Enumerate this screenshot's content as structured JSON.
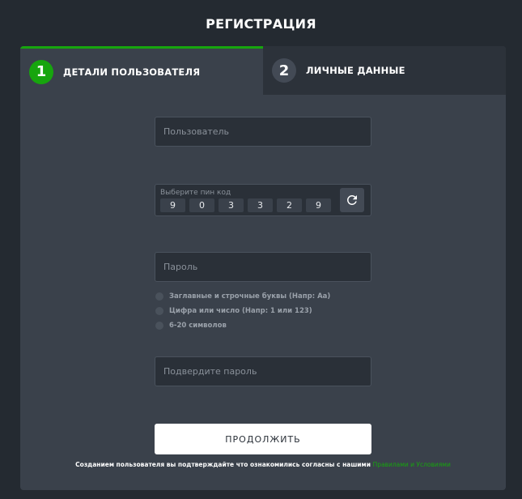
{
  "page": {
    "title": "РЕГИСТРАЦИЯ"
  },
  "tabs": [
    {
      "number": "1",
      "label": "ДЕТАЛИ ПОЛЬЗОВАТЕЛЯ",
      "active": true
    },
    {
      "number": "2",
      "label": "ЛИЧНЫЕ ДАННЫЕ",
      "active": false
    }
  ],
  "form": {
    "username_placeholder": "Пользователь",
    "pin": {
      "label": "Выберите пин код",
      "digits": [
        "9",
        "0",
        "3",
        "3",
        "2",
        "9"
      ],
      "refresh_icon": "refresh-icon"
    },
    "password_placeholder": "Пароль",
    "password_rules": [
      "Заглавные и строчные буквы (Напр: Aa)",
      "Цифра или число (Напр: 1 или 123)",
      "6-20 символов"
    ],
    "confirm_placeholder": "Подвердите пароль",
    "continue_label": "ПРОДОЛЖИТЬ"
  },
  "terms": {
    "text": "Созданием пользователя вы подтверждайте что ознакомились согласны с нашими ",
    "link": "Правилами и Условиями"
  },
  "colors": {
    "accent": "#17a50e",
    "background": "#242a31",
    "card": "#3a414b",
    "inactive_tab": "#2c323a"
  }
}
